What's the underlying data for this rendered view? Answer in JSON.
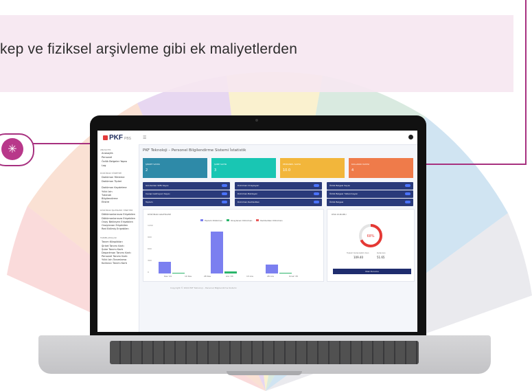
{
  "banner": {
    "text": "kep ve fiziksel arşivleme gibi ek maliyetlerden"
  },
  "accent_color": "#a7307f",
  "pin_icon": "cursor-click-icon",
  "app": {
    "logo": "PKF",
    "logo_sub": "PBS",
    "page_title": "PKF Teknoloji – Personel Bilgilendirme Sistemi İstatistik",
    "sidebar": {
      "sections": [
        {
          "head": "ANASAYFA",
          "items": [
            "Anasayfa",
            "Personel",
            "Özlük Belgeler Yapısı",
            "Log"
          ]
        },
        {
          "head": "DOKÜMAN YÖNETİMİ",
          "items": [
            "Doküman Yükleme",
            "Doküman Tipleri",
            "Doküman Kaydetme",
            "Yıllık İzin",
            "Tutanak",
            "Bilgilendirme",
            "Ekstre"
          ]
        },
        {
          "head": "DÖKÜMAN İŞLEMLERİ YÖNETİMİ",
          "items": [
            "Dökümanlarınıza Erişebilen",
            "Dökümanlarınıza Erişebilen",
            "Onay Bekleyen Erişebilen",
            "Onaylanan Erişebilen",
            "Red Edilmiş Erişebilen"
          ]
        },
        {
          "head": "TANIMLAMALAR",
          "items": [
            "Tanım Kitaplıkları",
            "Şirket Tanımı Kartı",
            "Şube Tanımı Kartı",
            "Departman Tanımı Kartı",
            "Personel Tanımı Kartı",
            "Yıllık İzin Tanımlama",
            "Kullanıcı Tanımı Kartı"
          ]
        }
      ]
    },
    "cards": [
      {
        "label": "ŞİRKET SAYISI",
        "value": "2",
        "color": "#2e8aa8"
      },
      {
        "label": "ŞUBE SAYISI",
        "value": "3",
        "color": "#19c6b3"
      },
      {
        "label": "PERSONEL SAYISI",
        "value": "10.0",
        "color": "#f2b63b"
      },
      {
        "label": "KULLANICI SAYISI",
        "value": "4",
        "color": "#ef7b4a"
      }
    ],
    "blue_rows": [
      [
        "Gönderilen SMS Sayısı",
        "Doküman Onaylayan",
        "Özlük Belgesi Sayısı"
      ],
      [
        "Cevap Gelmeyen Sayısı",
        "Doküman Bekleyen",
        "Özlük Belgesi Yüklenmeyen"
      ],
      [
        "Toplam",
        "Doküman Reddedilen",
        "Özlük Belgesi"
      ]
    ],
    "chart_panel": {
      "title": "DÖKÜMAN GRAFİKLERİ",
      "legend": [
        "Toplam Döküman",
        "Onaylanan Döküman",
        "Reddedilen Döküman"
      ],
      "legend_colors": [
        "#7b7ff0",
        "#2bb56b",
        "#e85a5a"
      ],
      "y_ticks": [
        "1200",
        "900",
        "600",
        "300",
        "0"
      ],
      "x_ticks": [
        "Kas '24",
        "10 Kas",
        "28 Kas",
        "Ara '24",
        "13 Ara",
        "28 Ara",
        "Ocak '25"
      ]
    },
    "gauge": {
      "title": "DİSK DURUMU",
      "percent_label": "68%",
      "percent": 0.68,
      "left_label": "Toplam Kullanılabilir Alan",
      "left_value": "109.40",
      "right_label": "Kullanılan",
      "right_value": "51.65",
      "button": "Disk Durumu"
    },
    "footer": "Copyright © 2024 PKF Teknoloji – Personel Bilgilendirme Sistemi"
  },
  "chart_data": {
    "type": "bar",
    "categories": [
      "Kas '24",
      "Ara '24",
      "Ocak '25"
    ],
    "series": [
      {
        "name": "Toplam Döküman",
        "values": [
          300,
          1050,
          220
        ]
      },
      {
        "name": "Onaylanan Döküman",
        "values": [
          20,
          60,
          20
        ]
      },
      {
        "name": "Reddedilen Döküman",
        "values": [
          0,
          0,
          0
        ]
      }
    ],
    "ylim": [
      0,
      1200
    ]
  }
}
